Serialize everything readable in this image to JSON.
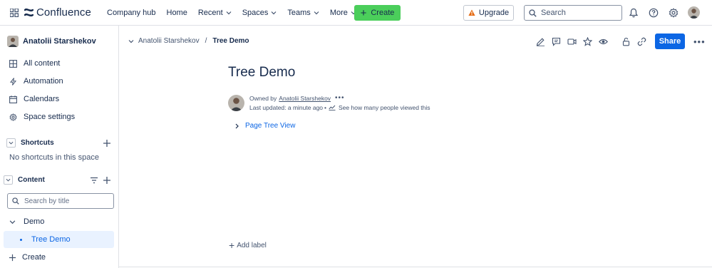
{
  "topbar": {
    "product": "Confluence",
    "nav": [
      "Company hub",
      "Home",
      "Recent",
      "Spaces",
      "Teams",
      "More"
    ],
    "create_label": "Create",
    "upgrade_label": "Upgrade",
    "search_placeholder": "Search",
    "accent_create": "#4bce5b",
    "icons": [
      "apps-grid-icon",
      "confluence-logo-icon",
      "bell-icon",
      "help-icon",
      "settings-icon",
      "avatar"
    ]
  },
  "sidebar": {
    "space_name": "Anatolii Starshekov",
    "items": [
      {
        "label": "All content",
        "icon": "grid-icon"
      },
      {
        "label": "Automation",
        "icon": "lightning-icon"
      },
      {
        "label": "Calendars",
        "icon": "calendar-icon"
      },
      {
        "label": "Space settings",
        "icon": "gear-icon"
      }
    ],
    "shortcuts_heading": "Shortcuts",
    "no_shortcuts": "No shortcuts in this space",
    "content_heading": "Content",
    "search_placeholder": "Search by title",
    "tree": {
      "parent": "Demo",
      "child": "Tree Demo"
    },
    "create_label": "Create"
  },
  "breadcrumb": {
    "space": "Anatolii Starshekov",
    "separator": "/",
    "page": "Tree Demo"
  },
  "page_actions": {
    "icons": [
      "edit-icon",
      "comment-icon",
      "video-icon",
      "star-icon",
      "watch-icon",
      "restrictions-icon",
      "copy-link-icon"
    ],
    "share_label": "Share",
    "share_color": "#0c66e4"
  },
  "page": {
    "title": "Tree Demo",
    "owned_by_prefix": "Owned by",
    "owner": "Anatolii Starshekov",
    "last_updated": "Last updated: a minute ago",
    "views_link": "See how many people viewed this",
    "tree_macro": "Page Tree View",
    "add_label": "Add label"
  }
}
